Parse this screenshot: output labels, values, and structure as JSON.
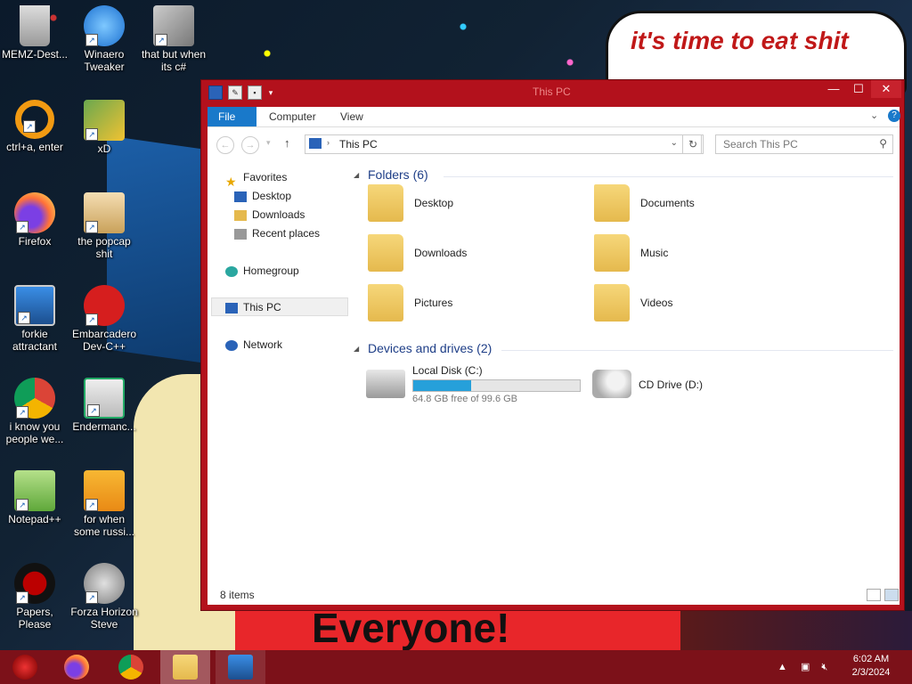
{
  "wallpaper": {
    "speech_text": "it's time to eat shit",
    "banner_text": "Everyone!"
  },
  "desktop_icons": [
    {
      "label": "MEMZ-Dest...",
      "icon": "recycle-bin-icon"
    },
    {
      "label": "Winaero Tweaker",
      "icon": "winaero-icon"
    },
    {
      "label": "that but when its c#",
      "icon": "stacked-windows-icon"
    },
    {
      "label": "ctrl+a, enter",
      "icon": "orange-ring-icon"
    },
    {
      "label": "xD",
      "icon": "hxd-icon"
    },
    {
      "label": "Firefox",
      "icon": "firefox-icon"
    },
    {
      "label": "the popcap shit",
      "icon": "popcap-icon"
    },
    {
      "label": "forkie attractant",
      "icon": "gear-monitor-icon"
    },
    {
      "label": "Embarcadero Dev-C++",
      "icon": "devcpp-icon"
    },
    {
      "label": "i know you people we...",
      "icon": "chrome-icon"
    },
    {
      "label": "Endermanc...",
      "icon": "window-app-icon"
    },
    {
      "label": "Notepad++",
      "icon": "notepadpp-icon"
    },
    {
      "label": "for when some russi...",
      "icon": "de-icon"
    },
    {
      "label": "Papers, Please",
      "icon": "papers-please-icon"
    },
    {
      "label": "Forza Horizon Steve",
      "icon": "flash-icon"
    }
  ],
  "window": {
    "title": "This PC",
    "ribbon_tabs": [
      "File",
      "Computer",
      "View"
    ],
    "address": "This PC",
    "search_placeholder": "Search This PC",
    "nav": {
      "favorites": "Favorites",
      "desktop": "Desktop",
      "downloads": "Downloads",
      "recent": "Recent places",
      "homegroup": "Homegroup",
      "this_pc": "This PC",
      "network": "Network"
    },
    "folders_header": "Folders (6)",
    "folders": [
      "Desktop",
      "Documents",
      "Downloads",
      "Music",
      "Pictures",
      "Videos"
    ],
    "drives_header": "Devices and drives (2)",
    "drives": [
      {
        "name": "Local Disk (C:)",
        "free": "64.8 GB free of 99.6 GB",
        "used_fraction": 0.35
      },
      {
        "name": "CD Drive (D:)"
      }
    ],
    "status": "8 items"
  },
  "taskbar": {
    "clock_time": "6:02 AM",
    "clock_date": "2/3/2024"
  },
  "colors": {
    "window_frame": "#b3111c",
    "taskbar": "#7c1119",
    "file_tab": "#1979ca",
    "progress_fill": "#26a0da"
  }
}
